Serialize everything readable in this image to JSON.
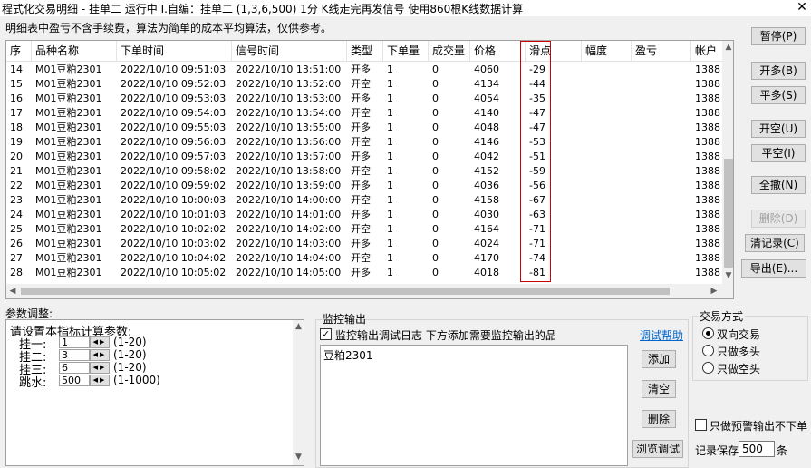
{
  "window": {
    "title": "程式化交易明细 - 挂单二 运行中  I.自编：挂单二 (1,3,6,500) 1分  K线走完再发信号 使用860根K线数据计算",
    "close_icon": "✕"
  },
  "notice": "明细表中盈亏不含手续费，算法为简单的成本平均算法，仅供参考。",
  "table": {
    "headers": [
      "序",
      "品种名称",
      "下单时间",
      "信号时间",
      "类型",
      "下单量",
      "成交量",
      "价格",
      "滑点",
      "幅度",
      "盈亏",
      "帐户"
    ],
    "rows": [
      {
        "seq": "14",
        "name": "M01豆粕2301",
        "order_time": "2022/10/10 09:51:03",
        "signal_time": "2022/10/10 13:51:00",
        "type": "开多",
        "qty": "1",
        "filled": "0",
        "price": "4060",
        "slip": "-29",
        "amp": "",
        "pnl": "",
        "account": "1388"
      },
      {
        "seq": "15",
        "name": "M01豆粕2301",
        "order_time": "2022/10/10 09:52:03",
        "signal_time": "2022/10/10 13:52:00",
        "type": "开空",
        "qty": "1",
        "filled": "0",
        "price": "4134",
        "slip": "-44",
        "amp": "",
        "pnl": "",
        "account": "1388"
      },
      {
        "seq": "16",
        "name": "M01豆粕2301",
        "order_time": "2022/10/10 09:53:03",
        "signal_time": "2022/10/10 13:53:00",
        "type": "开多",
        "qty": "1",
        "filled": "0",
        "price": "4054",
        "slip": "-35",
        "amp": "",
        "pnl": "",
        "account": "1388"
      },
      {
        "seq": "17",
        "name": "M01豆粕2301",
        "order_time": "2022/10/10 09:54:03",
        "signal_time": "2022/10/10 13:54:00",
        "type": "开空",
        "qty": "1",
        "filled": "0",
        "price": "4140",
        "slip": "-47",
        "amp": "",
        "pnl": "",
        "account": "1388"
      },
      {
        "seq": "18",
        "name": "M01豆粕2301",
        "order_time": "2022/10/10 09:55:03",
        "signal_time": "2022/10/10 13:55:00",
        "type": "开多",
        "qty": "1",
        "filled": "0",
        "price": "4048",
        "slip": "-47",
        "amp": "",
        "pnl": "",
        "account": "1388"
      },
      {
        "seq": "19",
        "name": "M01豆粕2301",
        "order_time": "2022/10/10 09:56:03",
        "signal_time": "2022/10/10 13:56:00",
        "type": "开空",
        "qty": "1",
        "filled": "0",
        "price": "4146",
        "slip": "-53",
        "amp": "",
        "pnl": "",
        "account": "1388"
      },
      {
        "seq": "20",
        "name": "M01豆粕2301",
        "order_time": "2022/10/10 09:57:03",
        "signal_time": "2022/10/10 13:57:00",
        "type": "开多",
        "qty": "1",
        "filled": "0",
        "price": "4042",
        "slip": "-51",
        "amp": "",
        "pnl": "",
        "account": "1388"
      },
      {
        "seq": "21",
        "name": "M01豆粕2301",
        "order_time": "2022/10/10 09:58:02",
        "signal_time": "2022/10/10 13:58:00",
        "type": "开空",
        "qty": "1",
        "filled": "0",
        "price": "4152",
        "slip": "-59",
        "amp": "",
        "pnl": "",
        "account": "1388"
      },
      {
        "seq": "22",
        "name": "M01豆粕2301",
        "order_time": "2022/10/10 09:59:02",
        "signal_time": "2022/10/10 13:59:00",
        "type": "开多",
        "qty": "1",
        "filled": "0",
        "price": "4036",
        "slip": "-56",
        "amp": "",
        "pnl": "",
        "account": "1388"
      },
      {
        "seq": "23",
        "name": "M01豆粕2301",
        "order_time": "2022/10/10 10:00:03",
        "signal_time": "2022/10/10 14:00:00",
        "type": "开空",
        "qty": "1",
        "filled": "0",
        "price": "4158",
        "slip": "-67",
        "amp": "",
        "pnl": "",
        "account": "1388"
      },
      {
        "seq": "24",
        "name": "M01豆粕2301",
        "order_time": "2022/10/10 10:01:03",
        "signal_time": "2022/10/10 14:01:00",
        "type": "开多",
        "qty": "1",
        "filled": "0",
        "price": "4030",
        "slip": "-63",
        "amp": "",
        "pnl": "",
        "account": "1388"
      },
      {
        "seq": "25",
        "name": "M01豆粕2301",
        "order_time": "2022/10/10 10:02:02",
        "signal_time": "2022/10/10 14:02:00",
        "type": "开空",
        "qty": "1",
        "filled": "0",
        "price": "4164",
        "slip": "-71",
        "amp": "",
        "pnl": "",
        "account": "1388"
      },
      {
        "seq": "26",
        "name": "M01豆粕2301",
        "order_time": "2022/10/10 10:03:02",
        "signal_time": "2022/10/10 14:03:00",
        "type": "开多",
        "qty": "1",
        "filled": "0",
        "price": "4024",
        "slip": "-71",
        "amp": "",
        "pnl": "",
        "account": "1388"
      },
      {
        "seq": "27",
        "name": "M01豆粕2301",
        "order_time": "2022/10/10 10:04:02",
        "signal_time": "2022/10/10 14:04:00",
        "type": "开空",
        "qty": "1",
        "filled": "0",
        "price": "4170",
        "slip": "-74",
        "amp": "",
        "pnl": "",
        "account": "1388"
      },
      {
        "seq": "28",
        "name": "M01豆粕2301",
        "order_time": "2022/10/10 10:05:02",
        "signal_time": "2022/10/10 14:05:00",
        "type": "开多",
        "qty": "1",
        "filled": "0",
        "price": "4018",
        "slip": "-81",
        "amp": "",
        "pnl": "",
        "account": "1388"
      }
    ],
    "highlight_color": "#d00000"
  },
  "buttons": {
    "pause": "暂停(P)",
    "open_long": "开多(B)",
    "close_long": "平多(S)",
    "open_short": "开空(U)",
    "close_short": "平空(I)",
    "cancel_all": "全撤(N)",
    "delete": "删除(D)",
    "clear_records": "清记录(C)",
    "export": "导出(E)..."
  },
  "params": {
    "label": "参数调整:",
    "prompt": "请设置本指标计算参数:",
    "items": [
      {
        "label": "挂一:",
        "value": "1",
        "range": "(1-20)"
      },
      {
        "label": "挂二:",
        "value": "3",
        "range": "(1-20)"
      },
      {
        "label": "挂三:",
        "value": "6",
        "range": "(1-20)"
      },
      {
        "label": "跳水:",
        "value": "500",
        "range": "(1-1000)"
      }
    ]
  },
  "monitor": {
    "label": "监控输出",
    "checkbox_label": "监控输出调试日志 下方添加需要监控输出的品",
    "checked": true,
    "help_link": "调试帮助",
    "items": [
      "豆粕2301"
    ],
    "add": "添加",
    "clear": "清空",
    "delete": "删除",
    "browse_debug": "浏览调试"
  },
  "trade_mode": {
    "label": "交易方式",
    "options": [
      "双向交易",
      "只做多头",
      "只做空头"
    ],
    "selected": 0
  },
  "alert_only_label": "只做预警输出不下单",
  "alert_only_checked": false,
  "record_save": {
    "label": "记录保存",
    "value": "500",
    "unit": "条"
  }
}
